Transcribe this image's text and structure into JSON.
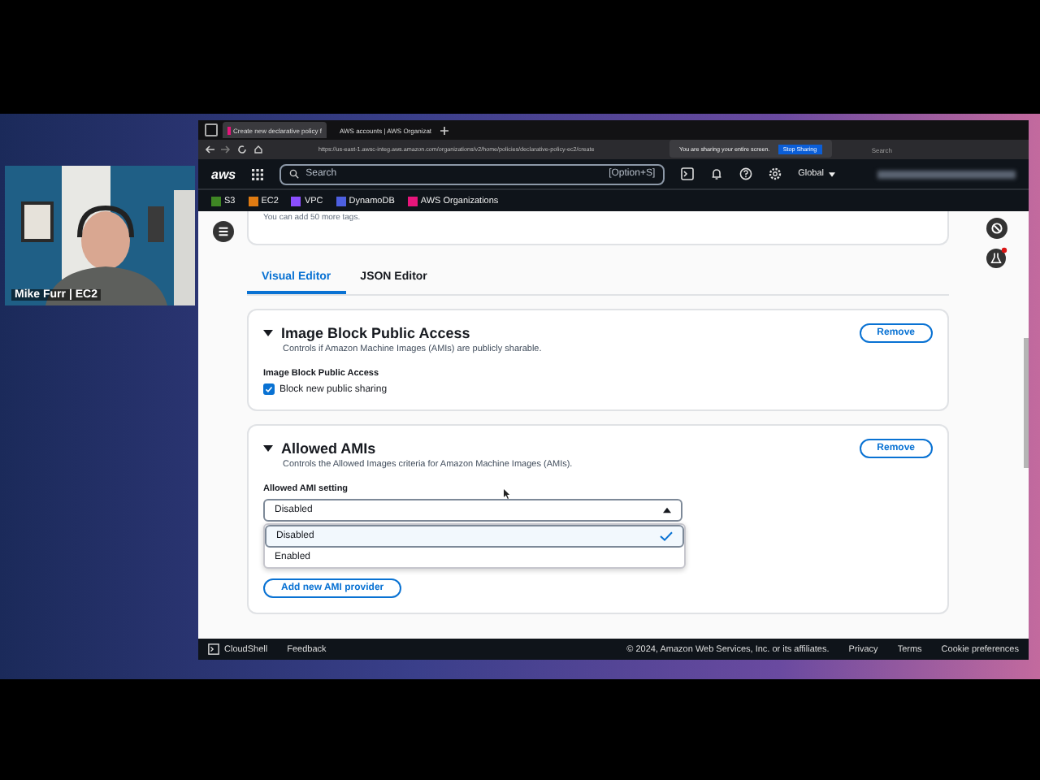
{
  "webcam": {
    "kind": "picture",
    "caption": "Mike Furr | EC2"
  },
  "browser": {
    "tabs": [
      {
        "title": "Create new declarative policy f",
        "selected": true
      },
      {
        "title": "AWS accounts | AWS Organizat",
        "selected": false
      }
    ],
    "url": "https://us-east-1.awsc-integ.aws.amazon.com/organizations/v2/home/policies/declarative-policy-ec2/create",
    "sharing_notice": "You are sharing your entire screen.",
    "stop_sharing": "Stop Sharing",
    "search_placeholder": "Search"
  },
  "console_nav": {
    "logo": "aws",
    "search_placeholder": "Search",
    "shortcut": "[Option+S]",
    "region": "Global"
  },
  "favorites": [
    {
      "label": "S3",
      "color": "#3f8624"
    },
    {
      "label": "EC2",
      "color": "#e07b12"
    },
    {
      "label": "VPC",
      "color": "#8c4fff"
    },
    {
      "label": "DynamoDB",
      "color": "#4d5fe0"
    },
    {
      "label": "AWS Organizations",
      "color": "#e7157b"
    }
  ],
  "tags_card": {
    "hint": "You can add 50 more tags."
  },
  "editor_tabs": [
    {
      "label": "Visual Editor",
      "selected": true
    },
    {
      "label": "JSON Editor",
      "selected": false
    }
  ],
  "sections": [
    {
      "kind": "checkbox",
      "title": "Image Block Public Access",
      "expanded": true,
      "description": "Controls if Amazon Machine Images (AMIs) are publicly sharable.",
      "remove": "Remove",
      "field_label": "Image Block Public Access",
      "option": {
        "label": "Block new public sharing",
        "checked": true
      }
    },
    {
      "kind": "select",
      "title": "Allowed AMIs",
      "expanded": true,
      "description": "Controls the Allowed Images criteria for Amazon Machine Images (AMIs).",
      "remove": "Remove",
      "field_label": "Allowed AMI setting",
      "value": "Disabled",
      "open": true,
      "options": [
        {
          "label": "Disabled",
          "selected": true
        },
        {
          "label": "Enabled",
          "selected": false
        }
      ],
      "add_button": "Add new AMI provider"
    }
  ],
  "footer": {
    "cloudshell": "CloudShell",
    "feedback": "Feedback",
    "copyright": "© 2024, Amazon Web Services, Inc. or its affiliates.",
    "links": [
      "Privacy",
      "Terms",
      "Cookie preferences"
    ]
  }
}
